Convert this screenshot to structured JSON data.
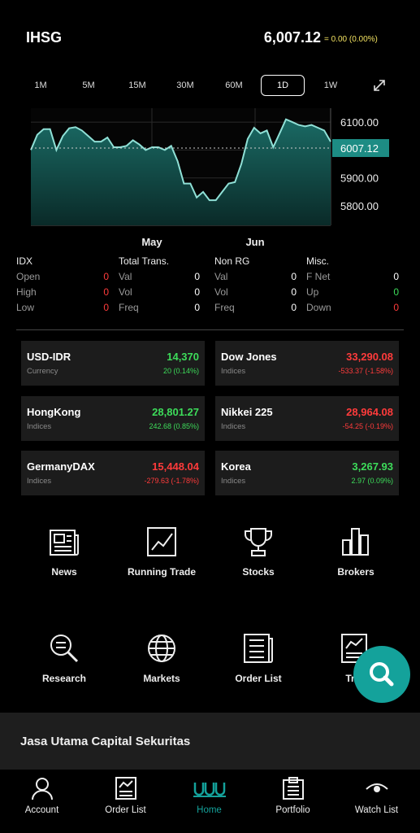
{
  "header": {
    "title": "IHSG",
    "price": "6,007.12",
    "change": "= 0.00 (0.00%)"
  },
  "tabs": [
    "1M",
    "5M",
    "15M",
    "30M",
    "60M",
    "1D",
    "1W"
  ],
  "active_tab": "1D",
  "chart_data": {
    "type": "area",
    "x_tick_labels": [
      "May",
      "Jun"
    ],
    "y_ticks": [
      "6100.00",
      "5900.00",
      "5800.00"
    ],
    "current_label": "6007.12",
    "current_value": 6007.12,
    "ylim": [
      5730,
      6150
    ],
    "values": [
      6000,
      6055,
      6075,
      6075,
      6000,
      6050,
      6078,
      6082,
      6070,
      6050,
      6030,
      6030,
      6045,
      6010,
      6010,
      6015,
      6035,
      6020,
      6000,
      6010,
      6010,
      6000,
      6015,
      5960,
      5880,
      5880,
      5830,
      5850,
      5820,
      5820,
      5850,
      5880,
      5885,
      5950,
      6040,
      6080,
      6060,
      6070,
      6010,
      6060,
      6110,
      6100,
      6090,
      6085,
      6090,
      6080,
      6070,
      6030
    ],
    "color": "#1d8c84"
  },
  "stats": {
    "idx": {
      "header": "IDX",
      "rows": [
        {
          "label": "Open",
          "value": "0"
        },
        {
          "label": "High",
          "value": "0"
        },
        {
          "label": "Low",
          "value": "0"
        }
      ]
    },
    "total": {
      "header": "Total Trans.",
      "rows": [
        {
          "label": "Val",
          "value": "0"
        },
        {
          "label": "Vol",
          "value": "0"
        },
        {
          "label": "Freq",
          "value": "0"
        }
      ]
    },
    "nonrg": {
      "header": "Non RG",
      "rows": [
        {
          "label": "Val",
          "value": "0"
        },
        {
          "label": "Vol",
          "value": "0"
        },
        {
          "label": "Freq",
          "value": "0"
        }
      ]
    },
    "misc": {
      "header": "Misc.",
      "rows": [
        {
          "label": "F Net",
          "value": "0"
        },
        {
          "label": "Up",
          "value": "0"
        },
        {
          "label": "Down",
          "value": "0"
        }
      ]
    }
  },
  "markets": [
    {
      "name": "USD-IDR",
      "sub": "Currency",
      "value": "14,370",
      "change": "20 (0.14%)",
      "dir": "up"
    },
    {
      "name": "Dow Jones",
      "sub": "Indices",
      "value": "33,290.08",
      "change": "-533.37 (-1.58%)",
      "dir": "down"
    },
    {
      "name": "HongKong",
      "sub": "Indices",
      "value": "28,801.27",
      "change": "242.68 (0.85%)",
      "dir": "up"
    },
    {
      "name": "Nikkei 225",
      "sub": "Indices",
      "value": "28,964.08",
      "change": "-54.25 (-0.19%)",
      "dir": "down"
    },
    {
      "name": "GermanyDAX",
      "sub": "Indices",
      "value": "15,448.04",
      "change": "-279.63 (-1.78%)",
      "dir": "down"
    },
    {
      "name": "Korea",
      "sub": "Indices",
      "value": "3,267.93",
      "change": "2.97 (0.09%)",
      "dir": "up"
    }
  ],
  "menu": [
    {
      "label": "News",
      "icon": "news-icon"
    },
    {
      "label": "Running Trade",
      "icon": "running-trade-icon"
    },
    {
      "label": "Stocks",
      "icon": "trophy-icon"
    },
    {
      "label": "Brokers",
      "icon": "bar-chart-icon"
    },
    {
      "label": "Research",
      "icon": "research-icon"
    },
    {
      "label": "Markets",
      "icon": "globe-icon"
    },
    {
      "label": "Order List",
      "icon": "order-list-icon"
    },
    {
      "label": "Trad",
      "icon": "trade-icon"
    }
  ],
  "company": "Jasa Utama Capital Sekuritas",
  "nav": [
    {
      "label": "Account",
      "icon": "account-icon"
    },
    {
      "label": "Order List",
      "icon": "order-list-icon"
    },
    {
      "label": "Home",
      "icon": "home-logo-icon",
      "active": true
    },
    {
      "label": "Portfolio",
      "icon": "portfolio-icon"
    },
    {
      "label": "Watch List",
      "icon": "watch-list-icon"
    }
  ],
  "colors": {
    "accent": "#14a29b",
    "up": "#3ddc5a",
    "down": "#ff3b3b",
    "card": "#1c1c1c"
  }
}
